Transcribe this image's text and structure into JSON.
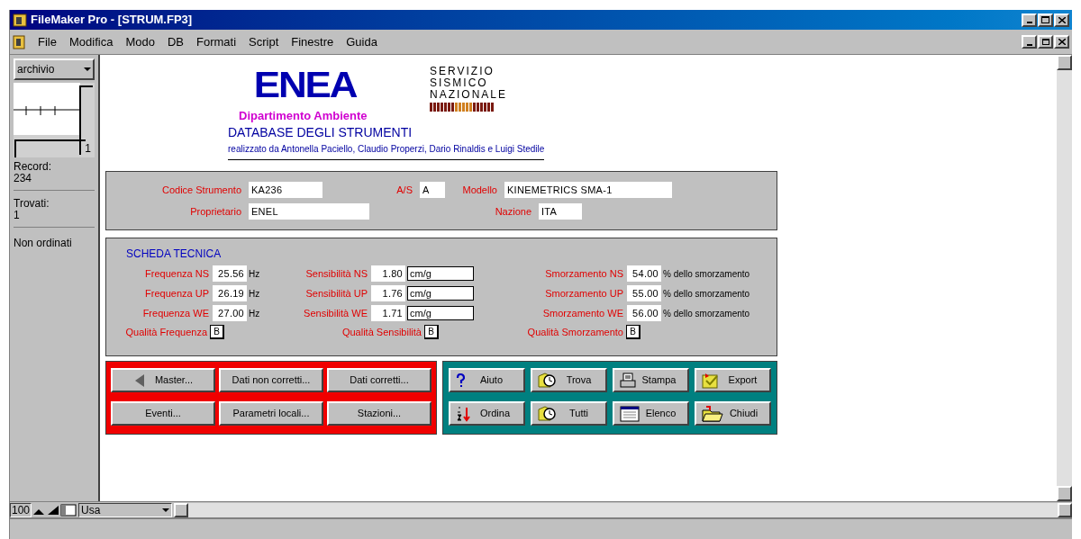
{
  "window": {
    "title": "FileMaker Pro - [STRUM.FP3]"
  },
  "menu": [
    "File",
    "Modifica",
    "Modo",
    "DB",
    "Formati",
    "Script",
    "Finestre",
    "Guida"
  ],
  "sidebar": {
    "layout": "archivio",
    "page": "1",
    "record_label": "Record:",
    "record_value": "234",
    "found_label": "Trovati:",
    "found_value": "1",
    "sort": "Non ordinati"
  },
  "header": {
    "logo": "ENEA",
    "department": "Dipartimento Ambiente",
    "title": "DATABASE DEGLI STRUMENTI",
    "credits": "realizzato da Antonella Paciello, Claudio Properzi, Dario Rinaldis e Luigi Stedile",
    "ssn": [
      "SERVIZIO",
      "SISMICO",
      "NAZIONALE"
    ]
  },
  "identity": [
    [
      {
        "label": "Codice Strumento",
        "value": "KA236"
      },
      {
        "label": "A/S",
        "value": "A"
      },
      {
        "label": "Modello",
        "value": "KINEMETRICS SMA-1"
      }
    ],
    [
      {
        "label": "Proprietario",
        "value": "ENEL"
      },
      {
        "label": "Nazione",
        "value": "ITA"
      }
    ]
  ],
  "scheda": {
    "title": "SCHEDA TECNICA",
    "rows": [
      [
        {
          "label": "Frequenza NS",
          "value": "25.56",
          "unit": "Hz"
        },
        {
          "label": "Sensibilità NS",
          "value": "1.80",
          "unit": "cm/g"
        },
        {
          "label": "Smorzamento NS",
          "value": "54.00",
          "unit": "% dello smorzamento"
        }
      ],
      [
        {
          "label": "Frequenza UP",
          "value": "26.19",
          "unit": "Hz"
        },
        {
          "label": "Sensibilità UP",
          "value": "1.76",
          "unit": "cm/g"
        },
        {
          "label": "Smorzamento UP",
          "value": "55.00",
          "unit": "% dello smorzamento"
        }
      ],
      [
        {
          "label": "Frequenza WE",
          "value": "27.00",
          "unit": "Hz"
        },
        {
          "label": "Sensibilità WE",
          "value": "1.71",
          "unit": "cm/g"
        },
        {
          "label": "Smorzamento WE",
          "value": "56.00",
          "unit": "% dello smorzamento"
        }
      ]
    ],
    "quality": [
      {
        "label": "Qualità Frequenza",
        "value": "B"
      },
      {
        "label": "Qualità Sensibilità",
        "value": "B"
      },
      {
        "label": "Qualità Smorzamento",
        "value": "B"
      }
    ]
  },
  "nav_buttons": [
    {
      "label": "Master..."
    },
    {
      "label": "Dati non corretti..."
    },
    {
      "label": "Dati corretti..."
    },
    {
      "label": "Eventi..."
    },
    {
      "label": "Parametri locali..."
    },
    {
      "label": "Stazioni..."
    }
  ],
  "tool_buttons": [
    {
      "label": "Aiuto"
    },
    {
      "label": "Trova"
    },
    {
      "label": "Stampa"
    },
    {
      "label": "Export"
    },
    {
      "label": "Ordina"
    },
    {
      "label": "Tutti"
    },
    {
      "label": "Elenco"
    },
    {
      "label": "Chiudi"
    }
  ],
  "bottom": {
    "zoom": "100",
    "mode": "Usa"
  }
}
